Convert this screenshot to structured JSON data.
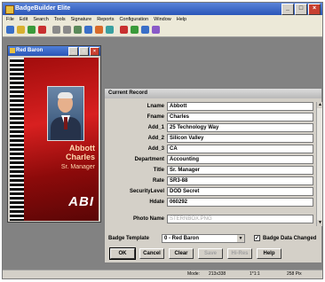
{
  "app": {
    "title": "BadgeBuilder Elite"
  },
  "menu": [
    "File",
    "Edit",
    "Search",
    "Tools",
    "Signature",
    "Reports",
    "Configuration",
    "Window",
    "Help"
  ],
  "toolbar": {
    "icons": [
      "new-icon",
      "open-icon",
      "save-icon",
      "print-icon",
      "cut-icon",
      "copy-icon",
      "paste-icon",
      "camera-icon",
      "scanner-icon",
      "signature-icon",
      "badge-icon",
      "report-icon",
      "search-icon",
      "help-icon"
    ],
    "colors": [
      "#3a6fc8",
      "#d8b030",
      "#3a9a3a",
      "#c83030",
      "#8a8a8a",
      "#8a8a8a",
      "#5a8a5a",
      "#3a6fc8",
      "#d86a2a",
      "#3aa0a0",
      "#c83030",
      "#3a9a3a",
      "#3a6fc8",
      "#8a5ac8"
    ]
  },
  "badge_window": {
    "title": "Red Baron"
  },
  "badge": {
    "first_name": "Abbott",
    "last_name": "Charles",
    "title": "Sr. Manager",
    "logo": "ABI"
  },
  "record_window": {
    "title": "Current Record"
  },
  "fields": [
    {
      "label": "Lname",
      "value": "Abbott"
    },
    {
      "label": "Fname",
      "value": "Charles"
    },
    {
      "label": "Add_1",
      "value": "25 Technology Way"
    },
    {
      "label": "Add_2",
      "value": "Silicon Valley"
    },
    {
      "label": "Add_3",
      "value": "CA"
    },
    {
      "label": "Department",
      "value": "Accounting"
    },
    {
      "label": "Title",
      "value": "Sr. Manager"
    },
    {
      "label": "Rate",
      "value": "SR3-88"
    },
    {
      "label": "SecurityLevel",
      "value": "DOD Secret"
    },
    {
      "label": "Hdate",
      "value": "060292"
    },
    {
      "label": "Photo Name",
      "value": "STERNBOX.PNG"
    }
  ],
  "template": {
    "label": "Badge Template",
    "value": "0 - Red Baron"
  },
  "badge_data_changed": {
    "label": "Badge Data Changed",
    "checked": true
  },
  "buttons": {
    "ok": "OK",
    "cancel": "Cancel",
    "clear": "Clear",
    "save": "Save",
    "hi_res": "Hi-Res",
    "help": "Help"
  },
  "status": {
    "mode": "Mode:",
    "size": "213x338",
    "page": "1*1:1",
    "zoom": "258 Pix"
  }
}
